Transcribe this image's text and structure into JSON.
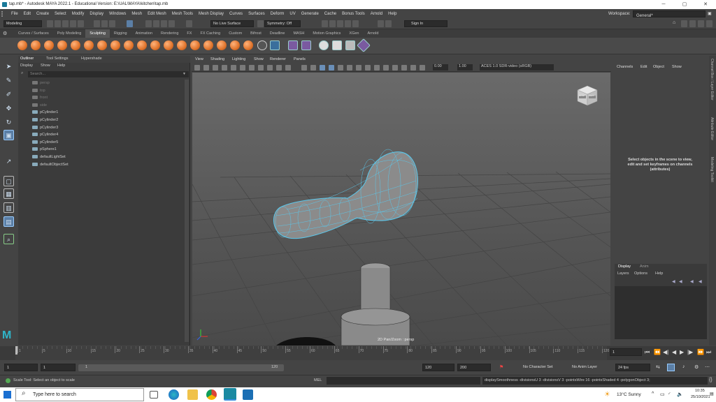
{
  "window": {
    "title": "tap.mb* - Autodesk MAYA 2022.1 - Educational Version: E:\\UAL\\MAYA\\kitchen\\tap.mb"
  },
  "menus": [
    "File",
    "Edit",
    "Create",
    "Select",
    "Modify",
    "Display",
    "Windows",
    "Mesh",
    "Edit Mesh",
    "Mesh Tools",
    "Mesh Display",
    "Curves",
    "Surfaces",
    "Deform",
    "UV",
    "Generate",
    "Cache",
    "Bonus Tools",
    "Arnold",
    "Help"
  ],
  "workspace": {
    "label": "Workspace:",
    "value": "General*"
  },
  "statusline": {
    "mode": "Modeling",
    "live_surface": "No Live Surface",
    "symmetry": "Symmetry: Off",
    "sign_in": "Sign In"
  },
  "shelf_tabs": [
    "Curves / Surfaces",
    "Poly Modeling",
    "Sculpting",
    "Rigging",
    "Animation",
    "Rendering",
    "FX",
    "FX Caching",
    "Custom",
    "Bifrost",
    "Deadline",
    "MASH",
    "Motion Graphics",
    "XGen",
    "Arnold"
  ],
  "shelf_active": "Sculpting",
  "outliner": {
    "tabs": [
      "Outliner",
      "Tool Settings",
      "Hypershade"
    ],
    "menu": [
      "Display",
      "Show",
      "Help"
    ],
    "search_placeholder": "Search...",
    "items": [
      {
        "label": "persp",
        "dim": true
      },
      {
        "label": "top",
        "dim": true
      },
      {
        "label": "front",
        "dim": true
      },
      {
        "label": "side",
        "dim": true
      },
      {
        "label": "pCylinder1",
        "dim": false
      },
      {
        "label": "pCylinder2",
        "dim": false
      },
      {
        "label": "pCylinder3",
        "dim": false
      },
      {
        "label": "pCylinder4",
        "dim": false
      },
      {
        "label": "pCylinder5",
        "dim": false
      },
      {
        "label": "pSphere1",
        "dim": false
      },
      {
        "label": "defaultLightSet",
        "dim": false
      },
      {
        "label": "defaultObjectSet",
        "dim": false
      }
    ]
  },
  "viewport": {
    "menu": [
      "View",
      "Shading",
      "Lighting",
      "Show",
      "Renderer",
      "Panels"
    ],
    "exposure": "0.00",
    "gamma": "1.00",
    "color_space": "ACES 1.0 SDR-video (sRGB)",
    "camera_label": "2D Pan/Zoom : persp",
    "cube_labels": {
      "front": "FRONT",
      "right": "RIGHT"
    }
  },
  "channel_box": {
    "menu": [
      "Channels",
      "Edit",
      "Object",
      "Show"
    ],
    "message": "Select objects in the scene to view, edit and set keyframes on channels (attributes)"
  },
  "layer_editor": {
    "tabs": [
      "Display",
      "Anim"
    ],
    "menu": [
      "Layers",
      "Options",
      "Help"
    ]
  },
  "side_tabs": [
    "Channel Box / Layer Editor",
    "Attribute Editor",
    "Modeling Toolkit"
  ],
  "timeline": {
    "ticks": [
      "1",
      "5",
      "10",
      "15",
      "20",
      "25",
      "30",
      "35",
      "40",
      "45",
      "50",
      "55",
      "60",
      "65",
      "70",
      "75",
      "80",
      "85",
      "90",
      "95",
      "100",
      "105",
      "110",
      "115",
      "120"
    ],
    "current_frame": "1"
  },
  "range": {
    "start": "1",
    "anim_start": "1",
    "range_start_label": "1",
    "range_end_label": "120",
    "end": "120",
    "anim_end": "200",
    "character_set": "No Character Set",
    "anim_layer": "No Anim Layer",
    "fps": "24 fps"
  },
  "helpline": {
    "message": "Scale Tool: Select an object to scale",
    "mel_label": "MEL",
    "command_result": "displaySmoothness -divisionsU 3 -divisionsV 3 -pointsWire 16 -pointsShaded 4 -polygonObject 3;"
  },
  "taskbar": {
    "search_placeholder": "Type here to search",
    "weather": "13°C  Sunny",
    "time": "10:35",
    "date": "25/10/2021"
  },
  "colors": {
    "accent": "#5bc8ec",
    "active_tab": "#555555",
    "shelf_orange": "#e0742c"
  }
}
